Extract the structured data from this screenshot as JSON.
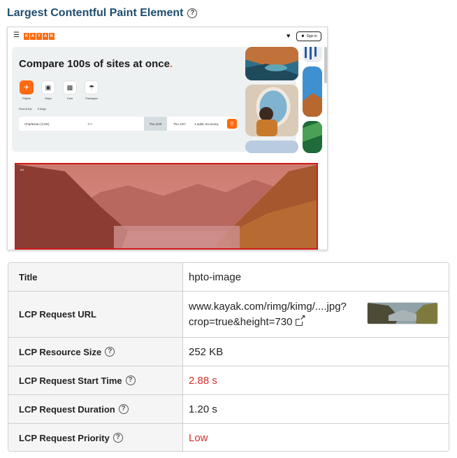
{
  "heading": {
    "title": "Largest Contentful Paint Element",
    "help_glyph": "?"
  },
  "screenshot": {
    "logo_letters": [
      "K",
      "A",
      "Y",
      "A",
      "K"
    ],
    "signin_label": "Sign in",
    "hero_title": "Compare 100s of sites at once",
    "hero_title_dot": ".",
    "verticals": [
      {
        "label": "Flights",
        "icon": "plane-icon"
      },
      {
        "label": "Stays",
        "icon": "bed-icon"
      },
      {
        "label": "Cars",
        "icon": "car-icon"
      },
      {
        "label": "Packages",
        "icon": "umbrella-icon"
      }
    ],
    "trip_type": "Round-trip",
    "bags": "0 bags",
    "from_value": "Charleston (CHS)",
    "to_placeholder": "To?",
    "depart_date": "Thu 2/20",
    "return_date": "Thu 2/27",
    "travelers": "1 adult, Economy",
    "lcp_tag": "Ad"
  },
  "table": {
    "rows": [
      {
        "label": "Title",
        "value": "hpto-image"
      },
      {
        "label": "LCP Request URL",
        "value_line1": "www.kayak.com/rimg/kimg/....jpg?",
        "value_line2": "crop=true&height=730"
      },
      {
        "label": "LCP Resource Size",
        "value": "252 KB"
      },
      {
        "label": "LCP Request Start Time",
        "value": "2.88 s",
        "status": "bad"
      },
      {
        "label": "LCP Request Duration",
        "value": "1.20 s"
      },
      {
        "label": "LCP Request Priority",
        "value": "Low",
        "status": "bad"
      }
    ]
  },
  "colors": {
    "accent_red": "#d32f2f",
    "heading_blue": "#1f4e6e",
    "kayak_orange": "#ff690f"
  }
}
